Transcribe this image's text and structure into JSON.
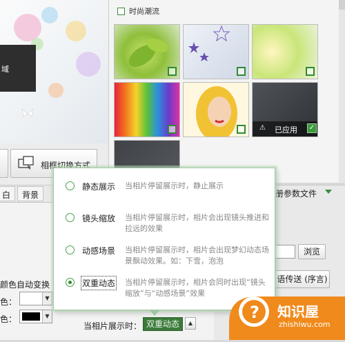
{
  "preview": {
    "overlay_text": "域"
  },
  "left_tools": {
    "frame_switch_label": "相框切换方式"
  },
  "gallery": {
    "category_label": "时尚潮流",
    "applied_label": "已应用"
  },
  "tabs": [
    {
      "label": "白"
    },
    {
      "label": "背景"
    }
  ],
  "lower": {
    "params_file_label": "册参数文件",
    "browse_label": "浏览",
    "music_label": "语传送 (序言)",
    "auto_color_label": "颜色自动变换",
    "color_label_1": "色：",
    "color_label_2": "色："
  },
  "popup": {
    "options": [
      {
        "title": "静态展示",
        "desc": "当相片停留展示时，静止展示",
        "selected": false
      },
      {
        "title": "镜头缩放",
        "desc": "当相片停留展示时，相片会出现镜头推进和拉远的效果",
        "selected": false
      },
      {
        "title": "动感场景",
        "desc": "当相片停留展示时，相片会出现梦幻动态场景飘动效果。如：下雪，泡泡",
        "selected": false
      },
      {
        "title": "双重动态",
        "desc": "当相片停留展示时，相片会同时出现“镜头缩放”与“动感场景”效果",
        "selected": true
      }
    ]
  },
  "bottom": {
    "label": "当相片展示时：",
    "value": "双重动态"
  },
  "watermark": {
    "brand": "知识屋",
    "url": "zhishiwu.com"
  },
  "colors": {
    "accent_green": "#2f8a2f",
    "popup_border": "#9fc79f",
    "combo_bg": "#3c7a3c"
  }
}
